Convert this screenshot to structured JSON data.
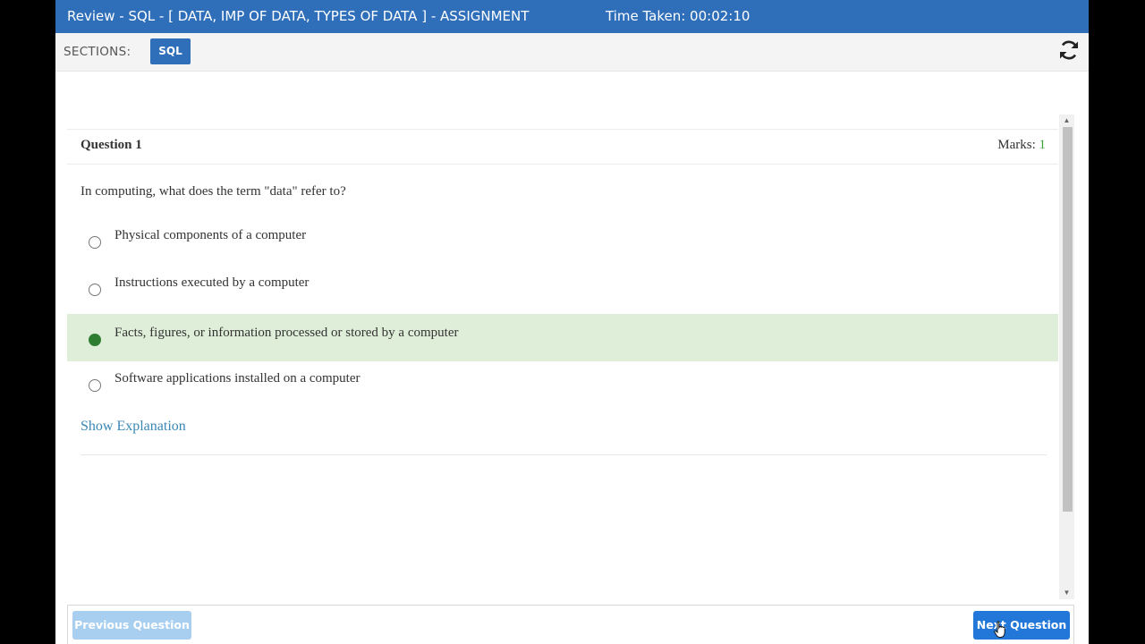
{
  "header": {
    "title": "Review - SQL - [ DATA, IMP OF DATA, TYPES OF DATA ] - ASSIGNMENT",
    "timer_label": "Time Taken: 00:02:10"
  },
  "sections": {
    "label": "SECTIONS:",
    "tabs": [
      {
        "label": "SQL",
        "active": true
      }
    ],
    "refresh_icon": "refresh-icon"
  },
  "question": {
    "number_label": "Question 1",
    "marks_label": "Marks:",
    "marks_value": "1",
    "text": "In computing, what does the term \"data\" refer to?",
    "options": [
      {
        "label": "Physical components of a computer",
        "selected": false
      },
      {
        "label": "Instructions executed by a computer",
        "selected": false
      },
      {
        "label": "Facts, figures, or information processed or stored by a computer",
        "selected": true
      },
      {
        "label": "Software applications installed on a computer",
        "selected": false
      }
    ],
    "explanation_link": "Show Explanation"
  },
  "footer": {
    "prev_label": "Previous Question",
    "next_label": "Next Question"
  },
  "colors": {
    "header_bg": "#2f6fba",
    "selected_bg": "#dfeed8",
    "selected_radio": "#2e7d32",
    "marks_value": "#3aa53a",
    "link": "#3a87b5",
    "next_button": "#2277d8",
    "prev_button_disabled": "#a8cff0"
  }
}
